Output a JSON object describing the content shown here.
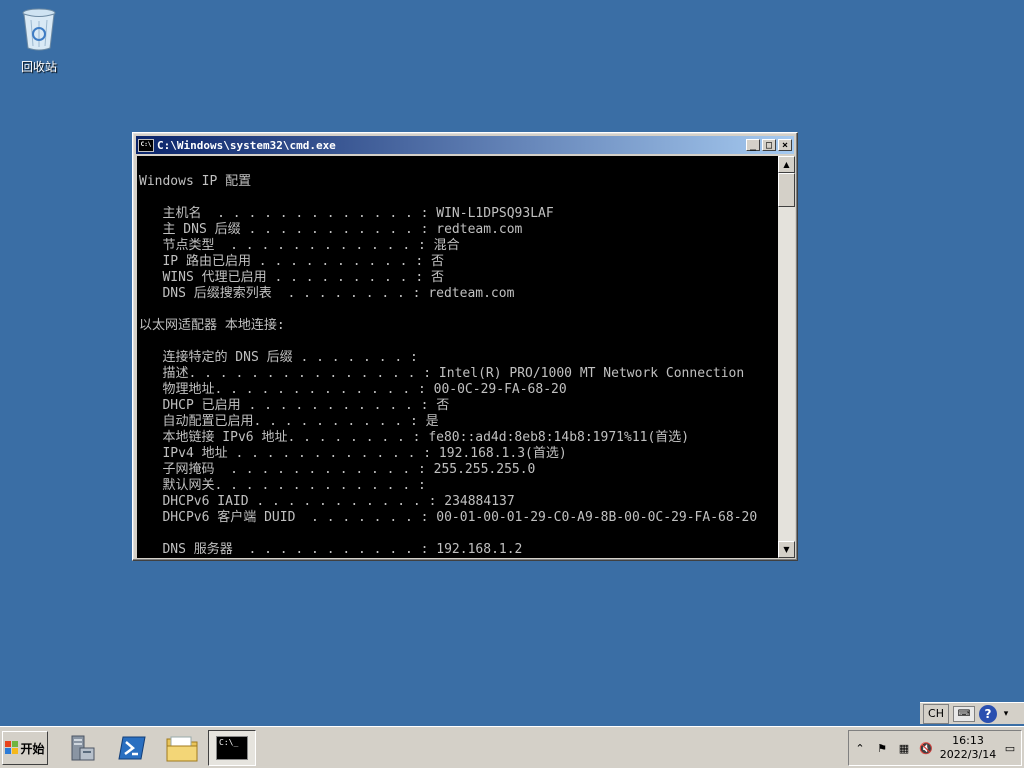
{
  "desktop": {
    "recycle_bin_label": "回收站"
  },
  "window": {
    "title": "C:\\Windows\\system32\\cmd.exe",
    "controls": {
      "minimize": "_",
      "maximize": "□",
      "close": "×"
    },
    "lines": [
      "Windows IP 配置",
      "",
      "   主机名  . . . . . . . . . . . . . : WIN-L1DPSQ93LAF",
      "   主 DNS 后缀 . . . . . . . . . . . : redteam.com",
      "   节点类型  . . . . . . . . . . . . : 混合",
      "   IP 路由已启用 . . . . . . . . . . : 否",
      "   WINS 代理已启用 . . . . . . . . . : 否",
      "   DNS 后缀搜索列表  . . . . . . . . : redteam.com",
      "",
      "以太网适配器 本地连接:",
      "",
      "   连接特定的 DNS 后缀 . . . . . . . :",
      "   描述. . . . . . . . . . . . . . . : Intel(R) PRO/1000 MT Network Connection",
      "   物理地址. . . . . . . . . . . . . : 00-0C-29-FA-68-20",
      "   DHCP 已启用 . . . . . . . . . . . : 否",
      "   自动配置已启用. . . . . . . . . . : 是",
      "   本地链接 IPv6 地址. . . . . . . . : fe80::ad4d:8eb8:14b8:1971%11(首选)",
      "   IPv4 地址 . . . . . . . . . . . . : 192.168.1.3(首选)",
      "   子网掩码  . . . . . . . . . . . . : 255.255.255.0",
      "   默认网关. . . . . . . . . . . . . :",
      "   DHCPv6 IAID . . . . . . . . . . . : 234884137",
      "   DHCPv6 客户端 DUID  . . . . . . . : 00-01-00-01-29-C0-A9-8B-00-0C-29-FA-68-20",
      "",
      "   DNS 服务器  . . . . . . . . . . . : 192.168.1.2"
    ]
  },
  "langbar": {
    "language": "CH",
    "help": "?"
  },
  "taskbar": {
    "start_label": "开始",
    "console_item_label": "C:\\_",
    "clock_time": "16:13",
    "clock_date": "2022/3/14"
  },
  "icons": {
    "recycle_bin": "recycle-bin-icon",
    "server_manager": "server-manager-icon",
    "powershell": "powershell-icon",
    "explorer": "folder-icon",
    "console": "cmd-icon"
  },
  "colors": {
    "desktop": "#3a6ea5",
    "console_bg": "#000000",
    "console_fg": "#c0c0c0",
    "title_start": "#0a246a",
    "title_end": "#a6caf0"
  }
}
